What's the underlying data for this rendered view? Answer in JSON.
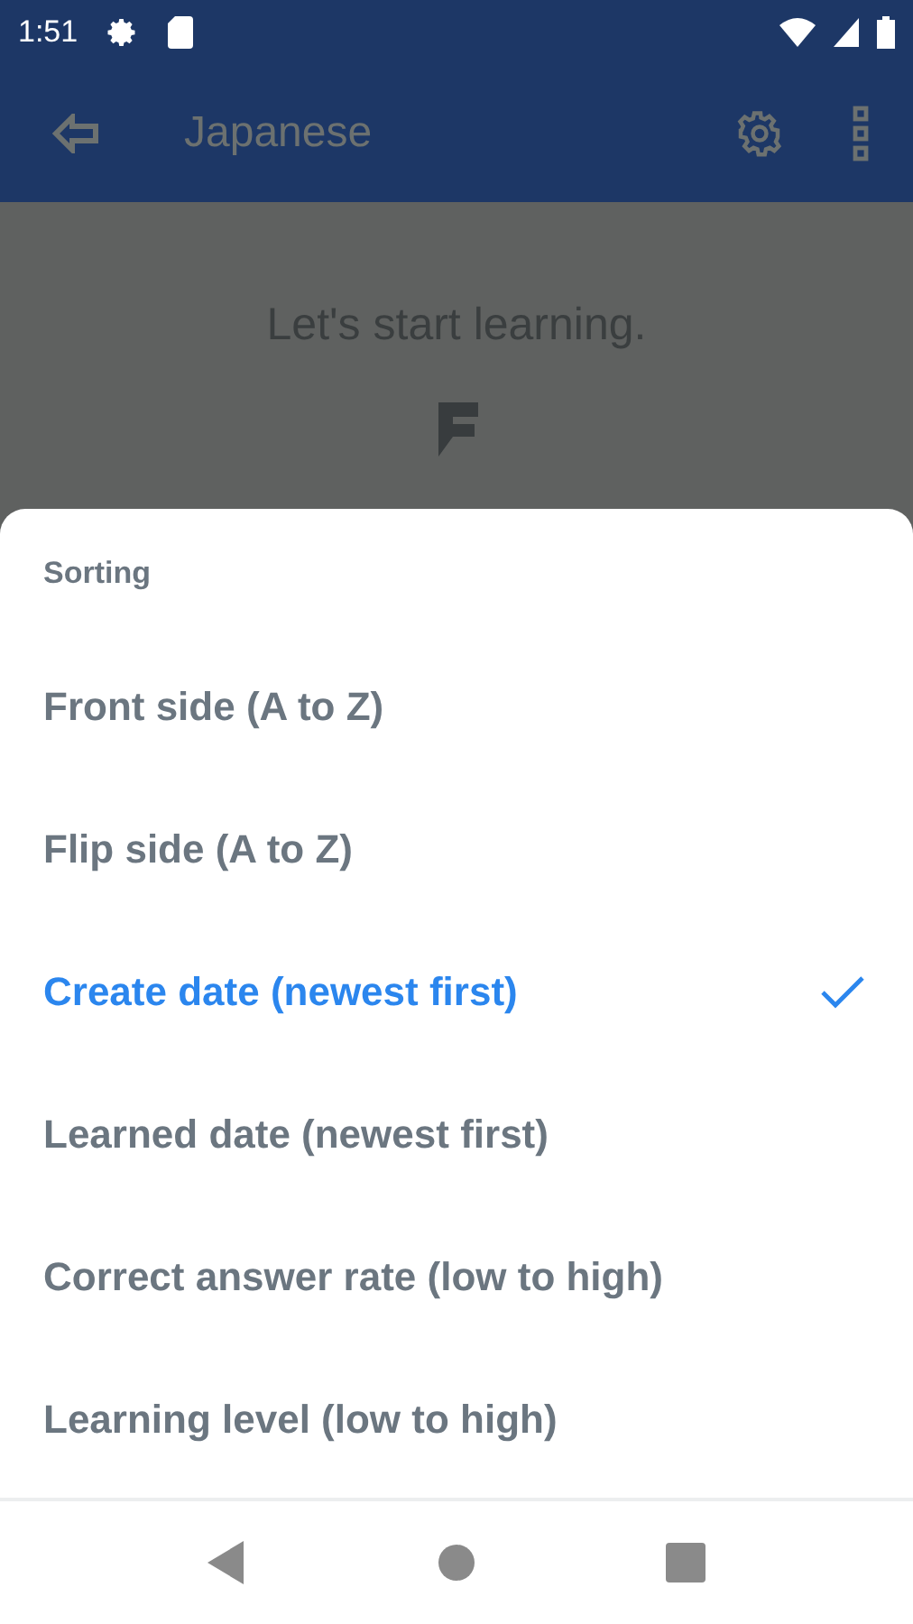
{
  "status_bar": {
    "time": "1:51"
  },
  "app_bar": {
    "title": "Japanese"
  },
  "background": {
    "message": "Let's start learning."
  },
  "sheet": {
    "title": "Sorting",
    "options": [
      {
        "label": "Front side (A to Z)",
        "selected": false
      },
      {
        "label": "Flip side (A to Z)",
        "selected": false
      },
      {
        "label": "Create date (newest first)",
        "selected": true
      },
      {
        "label": "Learned date (newest first)",
        "selected": false
      },
      {
        "label": "Correct answer rate (low to high)",
        "selected": false
      },
      {
        "label": "Learning level (low to high)",
        "selected": false
      }
    ]
  }
}
